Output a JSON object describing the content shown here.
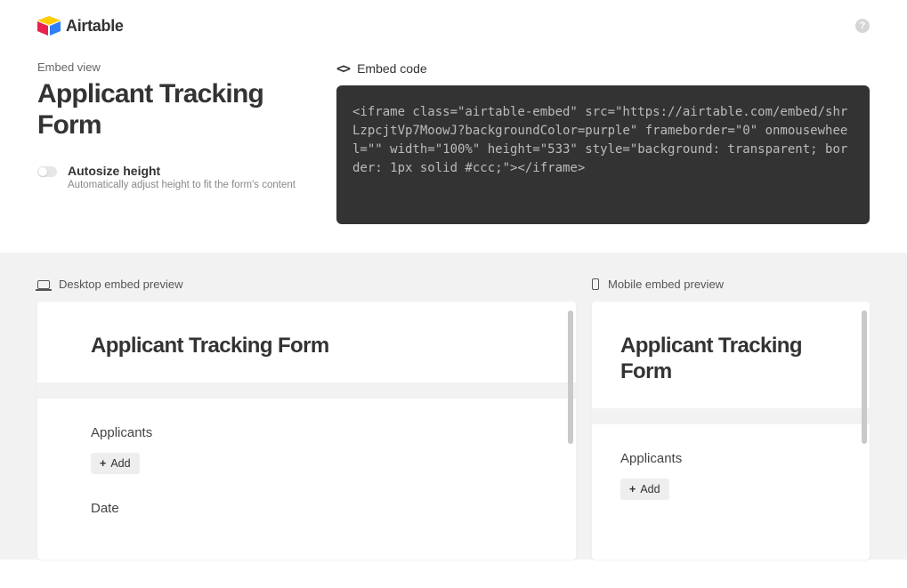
{
  "header": {
    "brand": "Airtable",
    "help": "?"
  },
  "left": {
    "eyebrow": "Embed view",
    "title": "Applicant Tracking Form",
    "toggle_label": "Autosize height",
    "toggle_desc": "Automatically adjust height to fit the form's content"
  },
  "right": {
    "code_header": "Embed code",
    "code": "<iframe class=\"airtable-embed\" src=\"https://airtable.com/embed/shrLzpcjtVp7MoowJ?backgroundColor=purple\" frameborder=\"0\" onmousewheel=\"\" width=\"100%\" height=\"533\" style=\"background: transparent; border: 1px solid #ccc;\"></iframe>"
  },
  "preview": {
    "desktop_label": "Desktop embed preview",
    "mobile_label": "Mobile embed preview",
    "form_title": "Applicant Tracking Form",
    "field1": "Applicants",
    "add_label": "Add",
    "field2": "Date"
  }
}
